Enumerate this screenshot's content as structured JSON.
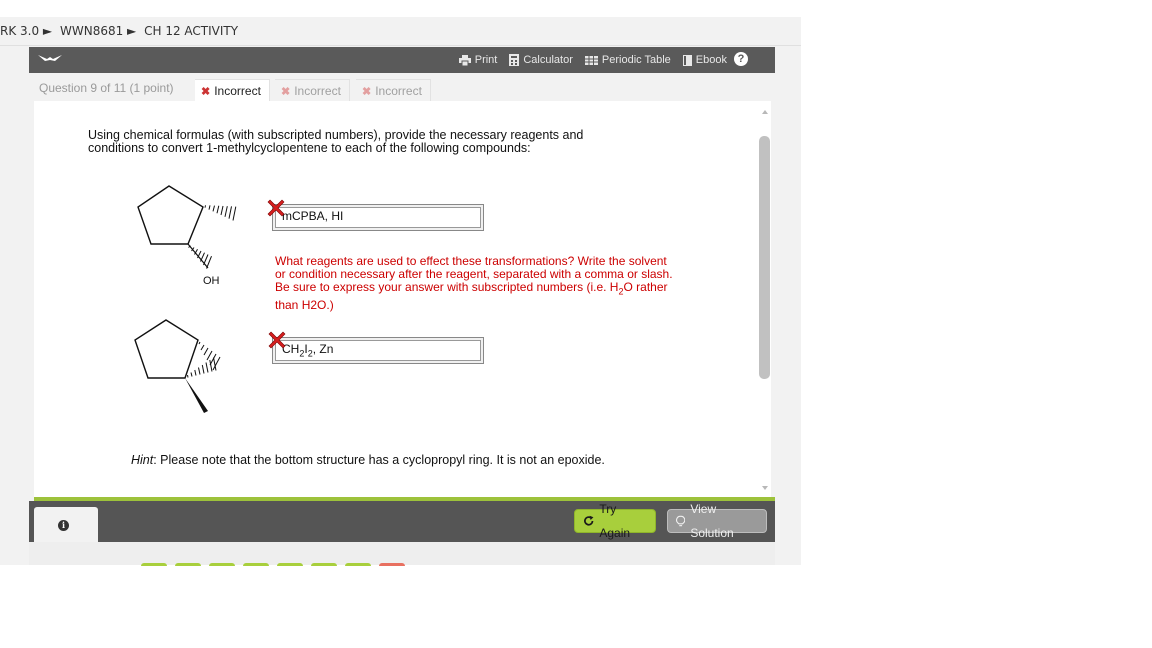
{
  "breadcrumb": [
    "RK 3.0 ►",
    "WWN8681 ►",
    "CH 12 ACTIVITY"
  ],
  "toolbar": {
    "logo_icon": "bird-logo-icon",
    "items": [
      {
        "label": "Print",
        "icon": "printer-icon"
      },
      {
        "label": "Calculator",
        "icon": "calculator-icon"
      },
      {
        "label": "Periodic Table",
        "icon": "table-icon"
      },
      {
        "label": "Ebook",
        "icon": "book-icon"
      }
    ],
    "help_icon": "?"
  },
  "question": {
    "number_label": "Question 9 of 11 (1 point)",
    "tabs": [
      {
        "label": "Incorrect",
        "state": "active"
      },
      {
        "label": "Incorrect",
        "state": "inactive"
      },
      {
        "label": "Incorrect",
        "state": "inactive"
      }
    ],
    "prompt": "Using chemical formulas (with subscripted numbers), provide the necessary reagents and conditions to convert 1-methylcyclopentene to each of the following compounds:",
    "molecule_1_label": "OH",
    "answer_1": "mCPBA, HI",
    "answer_2": {
      "pre": "CH",
      "sub1": "2",
      "mid": "I",
      "sub2": "2",
      "post": ", Zn"
    },
    "feedback": {
      "part1": "What reagents are used to effect these transformations? Write the solvent or condition necessary after the reagent, separated with a comma or slash. Be sure to express your answer with subscripted numbers (i.e. H",
      "sub": "2",
      "part2": "O rather than H2O.)"
    },
    "hint": {
      "label": "Hint",
      "text": ": Please note that the bottom structure has a cyclopropyl ring. It is not an epoxide."
    }
  },
  "footer": {
    "info_icon": "i",
    "try_again": "Try Again",
    "view_solution": "View Solution"
  },
  "colors": {
    "accent_green": "#a8cf3c",
    "error_red": "#cc0000",
    "toolbar_bg": "#5a5a5a"
  }
}
